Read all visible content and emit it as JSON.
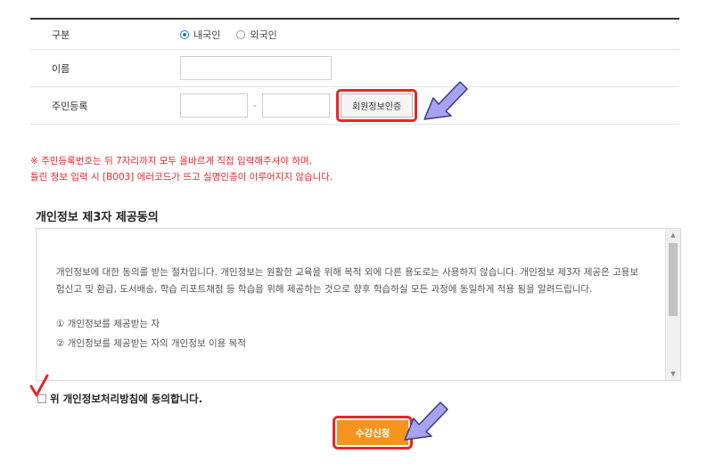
{
  "form": {
    "rows": [
      {
        "label": "구분"
      },
      {
        "label": "이름"
      },
      {
        "label": "주민등록"
      }
    ],
    "nationality": {
      "option1": "내국인",
      "option2": "외국인",
      "selected": "내국인"
    },
    "rrn_separator": "-",
    "verify_button": "회원정보인증"
  },
  "notice": {
    "line1": "※ 주민등록번호는 뒤 7자리까지 모두 올바르게 직접 입력해주셔야 하며,",
    "line2": "틀린 정보 입력 시 [B003] 에러코드가 뜨고 실명인증이 이루어지지 않습니다."
  },
  "section": {
    "title": "개인정보 제3자 제공동의"
  },
  "terms": {
    "paragraph": "개인정보에 대한 동의를 받는 절차입니다. 개인정보는 원활한 교육을 위해 목적 외에 다른 용도로는 사용하지 않습니다. 개인정보 제3자 제공은 고용보험신고 및 환급, 도서배송, 학습 리포트채점 등 학습을 위해 제공하는 것으로 향후 학습하실 모든 과정에 동일하게 적용 됨을 알려드립니다.",
    "item1": "① 개인정보를 제공받는 자",
    "item2": "② 개인정보를 제공받는 자의 개인정보 이용 목적"
  },
  "agree": {
    "label": "위 개인정보처리방침에 동의합니다.",
    "checked": false
  },
  "submit": {
    "label": "수강신청"
  },
  "colors": {
    "highlight": "#e8262a",
    "submit_bg": "#f7941d",
    "arrow": "#a7a3f0"
  },
  "icons": [
    "radio-selected-icon",
    "radio-empty-icon",
    "scroll-up-icon",
    "scroll-down-icon",
    "checkmark-annotation-icon",
    "pointer-arrow-icon"
  ]
}
